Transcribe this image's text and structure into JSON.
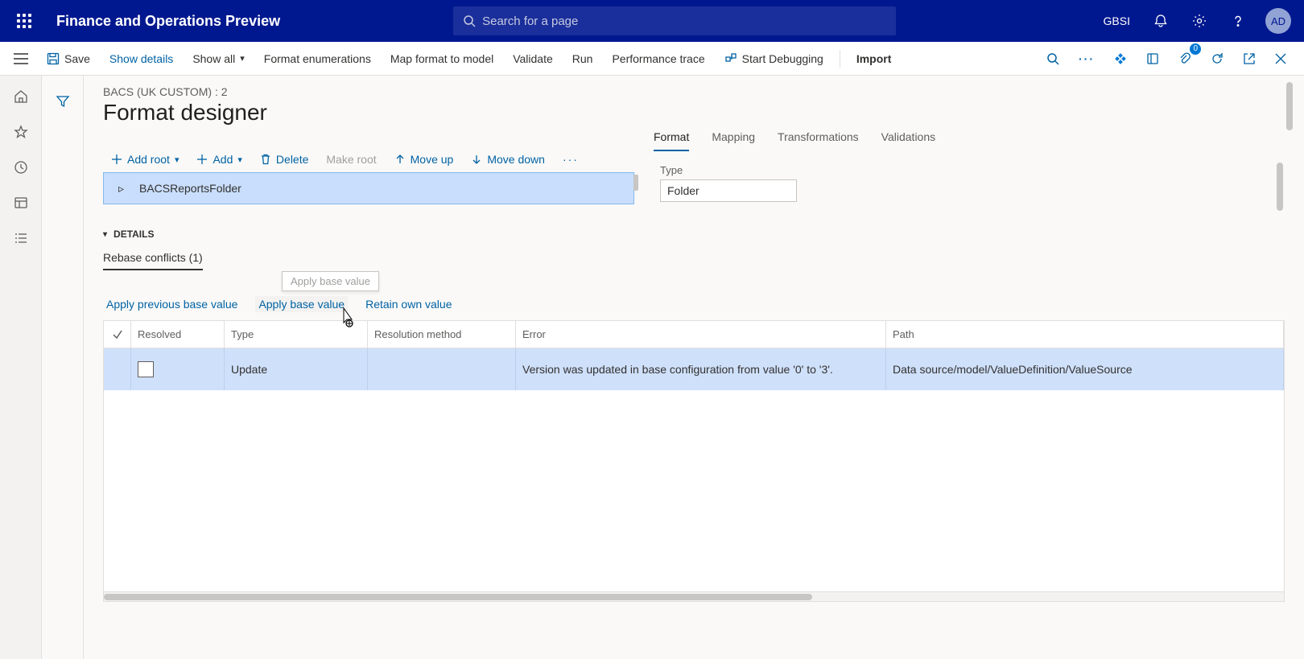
{
  "header": {
    "app_title": "Finance and Operations Preview",
    "search_placeholder": "Search for a page",
    "company": "GBSI",
    "avatar": "AD"
  },
  "action_bar": {
    "save": "Save",
    "show_details": "Show details",
    "show_all": "Show all",
    "format_enum": "Format enumerations",
    "map_format": "Map format to model",
    "validate": "Validate",
    "run": "Run",
    "perf_trace": "Performance trace",
    "start_debug": "Start Debugging",
    "import": "Import",
    "notif_count": "0"
  },
  "page": {
    "breadcrumb": "BACS (UK CUSTOM) : 2",
    "title": "Format designer"
  },
  "toolbar": {
    "add_root": "Add root",
    "add": "Add",
    "delete": "Delete",
    "make_root": "Make root",
    "move_up": "Move up",
    "move_down": "Move down"
  },
  "tree": {
    "root_item": "BACSReportsFolder"
  },
  "right_tabs": {
    "format": "Format",
    "mapping": "Mapping",
    "transformations": "Transformations",
    "validations": "Validations",
    "type_label": "Type",
    "type_value": "Folder"
  },
  "details": {
    "header": "DETAILS",
    "tab": "Rebase conflicts (1)",
    "apply_prev": "Apply previous base value",
    "apply_base": "Apply base value",
    "retain_own": "Retain own value",
    "tooltip": "Apply base value"
  },
  "grid": {
    "headers": {
      "resolved": "Resolved",
      "type": "Type",
      "method": "Resolution method",
      "error": "Error",
      "path": "Path"
    },
    "row": {
      "type": "Update",
      "method": "",
      "error": "Version was updated in base configuration from value '0' to '3'.",
      "path": "Data source/model/ValueDefinition/ValueSource"
    }
  }
}
